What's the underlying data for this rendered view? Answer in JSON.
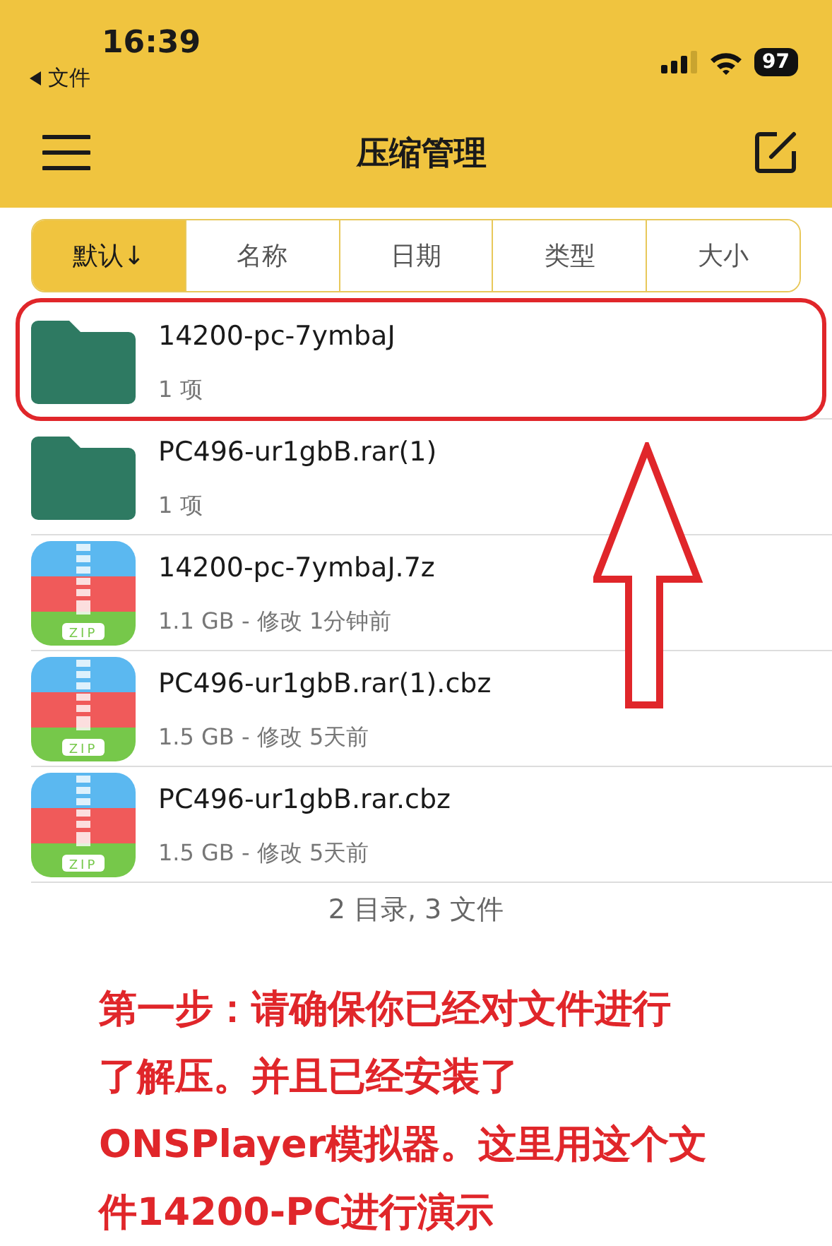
{
  "status_bar": {
    "time": "16:39",
    "back_label": "文件",
    "battery": "97"
  },
  "nav": {
    "title": "压缩管理"
  },
  "sort_tabs": [
    {
      "label": "默认↓",
      "selected": true
    },
    {
      "label": "名称",
      "selected": false
    },
    {
      "label": "日期",
      "selected": false
    },
    {
      "label": "类型",
      "selected": false
    },
    {
      "label": "大小",
      "selected": false
    }
  ],
  "files": [
    {
      "kind": "folder",
      "name": "14200-pc-7ymbaJ",
      "detail": "1 项",
      "highlighted": true
    },
    {
      "kind": "folder",
      "name": "PC496-ur1gbB.rar(1)",
      "detail": "1 项",
      "highlighted": false
    },
    {
      "kind": "archive",
      "name": "14200-pc-7ymbaJ.7z",
      "detail": "1.1 GB - 修改 1分钟前",
      "icon_label": "ZIP",
      "highlighted": false
    },
    {
      "kind": "archive",
      "name": "PC496-ur1gbB.rar(1).cbz",
      "detail": "1.5 GB - 修改 5天前",
      "icon_label": "ZIP",
      "highlighted": false
    },
    {
      "kind": "archive",
      "name": "PC496-ur1gbB.rar.cbz",
      "detail": "1.5 GB - 修改 5天前",
      "icon_label": "ZIP",
      "highlighted": false
    }
  ],
  "summary": "2 目录, 3 文件",
  "caption_lines": [
    "第一步：请确保你已经对文件进行",
    "了解压。并且已经安装了",
    "ONSPlayer模拟器。这里用这个文",
    "件14200-PC进行演示"
  ]
}
